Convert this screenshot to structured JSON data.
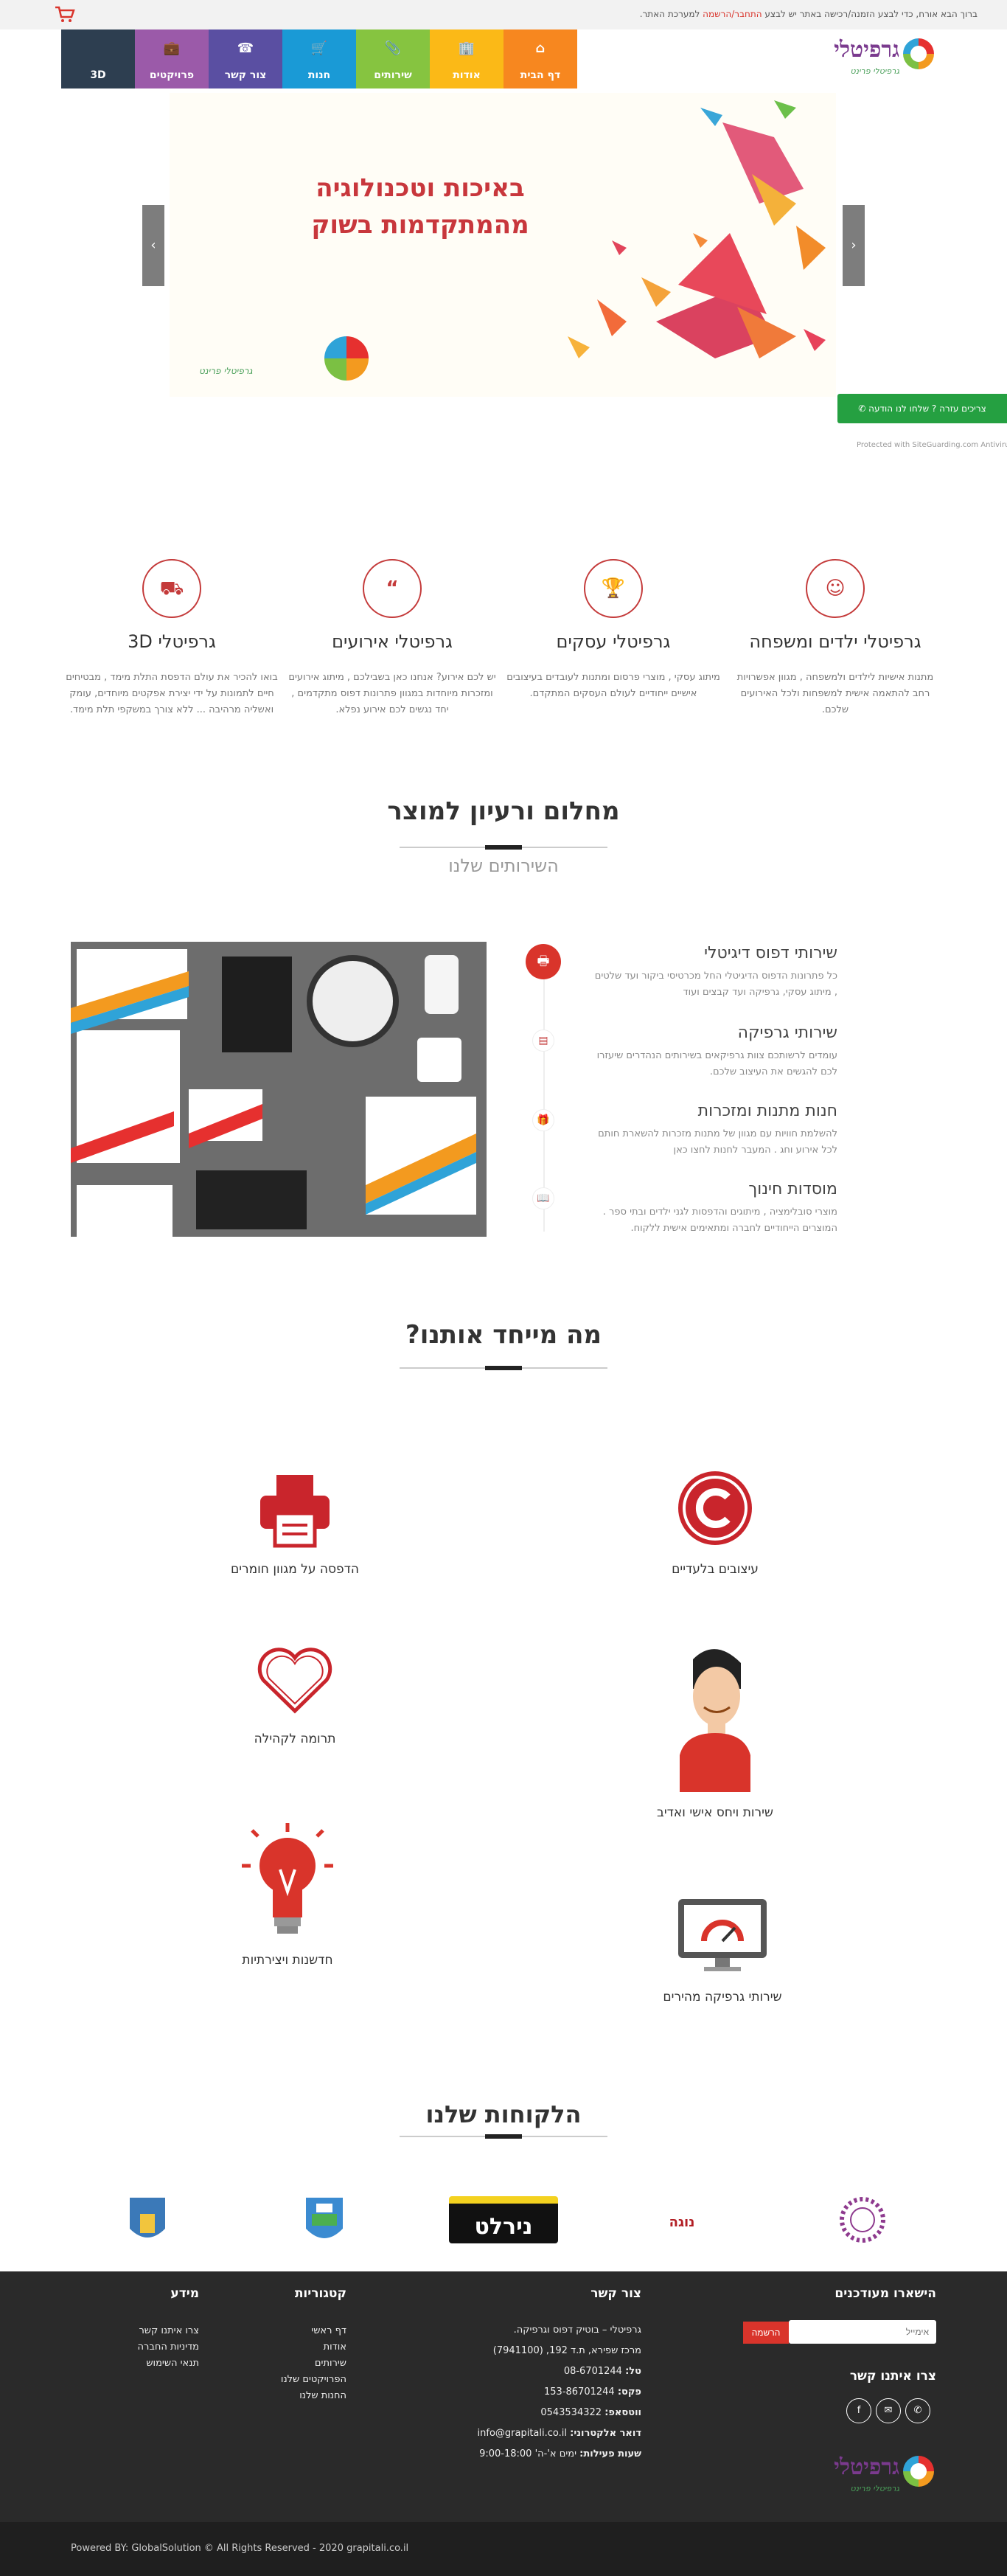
{
  "topbar": {
    "message_prefix": "ברוך הבא אורח, כדי לבצע הזמנה/רכישה באתר יש לבצע ",
    "login_link": "התחבר/הרשמה",
    "message_suffix": " למערכת האתר."
  },
  "logo": {
    "name": "גרפיטלי",
    "slogan": "גרפיטלי פרינט"
  },
  "nav": {
    "items": [
      {
        "label": "דף הבית",
        "icon": "home-icon",
        "color": "#f7871f"
      },
      {
        "label": "אודות",
        "icon": "building-icon",
        "color": "#fbb917"
      },
      {
        "label": "שירותים",
        "icon": "paperclip-icon",
        "color": "#86c440"
      },
      {
        "label": "חנות",
        "icon": "cart-icon",
        "color": "#1a9ad6"
      },
      {
        "label": "צור קשר",
        "icon": "phone-icon",
        "color": "#5a4fa2"
      },
      {
        "label": "פרויקטים",
        "icon": "briefcase-icon",
        "color": "#9b5aa9"
      },
      {
        "label": "3D",
        "icon": "",
        "color": "#2d3e50"
      }
    ]
  },
  "hero": {
    "headline_line1": "באיכות וטכנולוגיה",
    "headline_line2": "מהמתקדמות בשוק",
    "signature": "גרפיטלי פרינט"
  },
  "whatsapp": {
    "label": "צריכים עזרה ? שלחו לנו הודעה"
  },
  "protected": "Protected with SiteGuarding.com Antivirus",
  "features": [
    {
      "title": "גרפיטלי ילדים ומשפחה",
      "icon": "kids-icon",
      "desc": "מתנות אישיות לילדים ולמשפחה , מגוון אפשרויות רחב להתאמה אישית למשפחות ולכל האירועים שלכם."
    },
    {
      "title": "גרפיטלי עסקים",
      "icon": "trophy-icon",
      "desc": "מיתוג עסקי , מוצרי פרסום ומתנות לעובדים בעיצובים אישיים ייחודיים לעולם העסקים המתקדם."
    },
    {
      "title": "גרפיטלי אירועים",
      "icon": "quote-icon",
      "desc": "יש לכם אירוע? אנחנו כאן בשבילכם , מיתוג אירועים ומזכרות מיוחדות במגוון פתרונות דפוס מתקדמים , יחד נגשים לכם אירוע נפלא."
    },
    {
      "title": "גרפיטלי 3D",
      "icon": "truck-icon",
      "desc": "בואו להכיר את עולם הדפסת התלת מימד , מבטיחים חיים לתמונות על ידי יצירת אפקטים מיוחדים, עומק ואשליה מרהיבה ... ללא צורך במשקפי תלת מימד."
    }
  ],
  "services": {
    "title": "מחלום ורעיון למוצר",
    "subtitle": "השירותים שלנו",
    "items": [
      {
        "title": "שירותי דפוס דיגיטלי",
        "icon": "printer-icon",
        "desc": "כל פתרונות הדפוס הדיגיטלי החל מכרטיסי ביקור ועד שלטים , מיתוג עסקי, גרפיקה ועד קבצים ועוד"
      },
      {
        "title": "שירותי גרפיקה",
        "icon": "image-icon",
        "desc": "עומדים לרשותכם צוות גרפיקאים בשירותים הנהדרים שיעזרו לכם להגשים את העיצוב שלכם."
      },
      {
        "title": "חנות מתנות ומזכרות",
        "icon": "gift-icon",
        "desc": "להשלמת חוויות עם מגוון של מתנות מזכרות להשארת חותם לכל אירוע וחג . המעבר לחנות לחצו כאן"
      },
      {
        "title": "מוסדות חינוך",
        "icon": "book-icon",
        "desc": "מוצרי סובלימציה , מיתוגים והדפסות לגני ילדים ובתי ספר . המוצרים הייחודיים לחברה ומתאימים אישית ללקוח."
      }
    ]
  },
  "unique": {
    "title": "מה מייחד אותנו?",
    "items": [
      {
        "label": "עיצובים בלעדיים",
        "icon": "copyright-icon"
      },
      {
        "label": "הדפסה על מגוון חומרים",
        "icon": "printer-icon"
      },
      {
        "label": "שירות ויחס אישי ואדיב",
        "icon": "person-icon"
      },
      {
        "label": "תרומה לקהילה",
        "icon": "heart-icon"
      },
      {
        "label": "חדשנות ויצירתיות",
        "icon": "lightbulb-icon"
      },
      {
        "label": "שירותי גרפיקה מהירים",
        "icon": "monitor-gauge-icon"
      }
    ]
  },
  "clients": {
    "title": "הלקוחות שלנו",
    "logos": [
      "ירושלים",
      "נירלט",
      "נוגה",
      "לוגו-עירייה",
      "לוגו-פרחוני"
    ]
  },
  "footer": {
    "newsletter_title": "הישארו מעודכנים",
    "email_placeholder": "אימייל",
    "signup_label": "הרשמה",
    "social_title": "צרו איתנו קשר",
    "contact_title": "צור קשר",
    "contact_lines": {
      "company": "גרפיטלי – בוטיק דפוס וגרפיקה.",
      "address": "מרכז שפירא, ת.ד 192, (7941100)",
      "tel_label": "טל:",
      "tel": "08-6701244",
      "fax_label": "פקס:",
      "fax": "153-86701244",
      "whatsapp_label": "ווטסאפ:",
      "whatsapp": "0543534322",
      "email_label": "דואר אלקטרוני:",
      "email": "info@grapitali.co.il",
      "hours_label": "שעות פעילות:",
      "hours": "ימים א'-ה' 9:00-18:00"
    },
    "categories_title": "קטגוריות",
    "categories": [
      "דף ראשי",
      "אודות",
      "שירותים",
      "הפרויקטים שלנו",
      "החנות שלנו"
    ],
    "info_title": "מידע",
    "info": [
      "צרו איתנו קשר",
      "מדיניות החברה",
      "תנאי השימוש"
    ]
  },
  "copyright": "Powered BY: GlobalSolution © All Rights Reserved - 2020 grapitali.co.il"
}
